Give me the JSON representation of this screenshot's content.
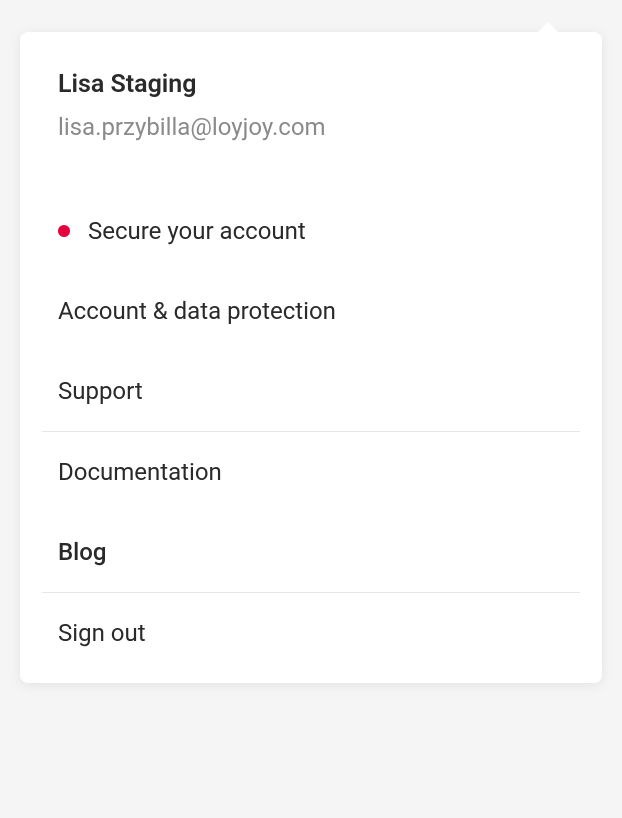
{
  "user": {
    "name": "Lisa Staging",
    "email": "lisa.przybilla@loyjoy.com"
  },
  "menu": {
    "secure_account": "Secure your account",
    "account_protection": "Account & data protection",
    "support": "Support",
    "documentation": "Documentation",
    "blog": "Blog",
    "sign_out": "Sign out"
  },
  "colors": {
    "alert_dot": "#e6003c"
  }
}
